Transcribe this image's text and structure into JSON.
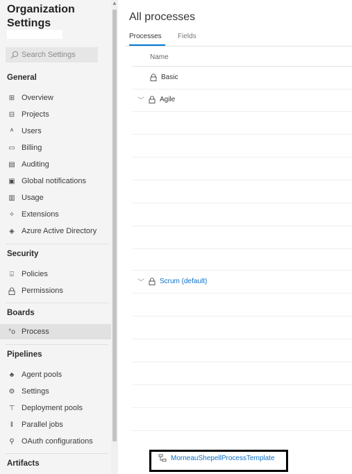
{
  "sidebar": {
    "title": "Organization Settings",
    "search": {
      "placeholder": "Search Settings"
    },
    "sections": {
      "general": "General",
      "security": "Security",
      "boards": "Boards",
      "pipelines": "Pipelines",
      "artifacts": "Artifacts"
    },
    "general_items": [
      "Overview",
      "Projects",
      "Users",
      "Billing",
      "Auditing",
      "Global notifications",
      "Usage",
      "Extensions",
      "Azure Active Directory"
    ],
    "security_items": [
      "Policies",
      "Permissions"
    ],
    "boards_items": [
      "Process"
    ],
    "pipelines_items": [
      "Agent pools",
      "Settings",
      "Deployment pools",
      "Parallel jobs",
      "OAuth configurations"
    ],
    "selected_item": "Process"
  },
  "main": {
    "title": "All processes",
    "tabs": [
      "Processes",
      "Fields"
    ],
    "active_tab": "Processes",
    "column_name": "Name",
    "processes": [
      {
        "name": "Basic"
      },
      {
        "name": "Agile"
      },
      {
        "name": "Scrum (default)"
      }
    ],
    "template_name": "MorneauShepellProcessTemplate"
  },
  "colors": {
    "accent": "#0078d4",
    "link": "#0b6ec5",
    "sidebar_bg": "#f4f4f4",
    "selected_bg": "#e1e1e1",
    "highlight_border": "#000000"
  }
}
